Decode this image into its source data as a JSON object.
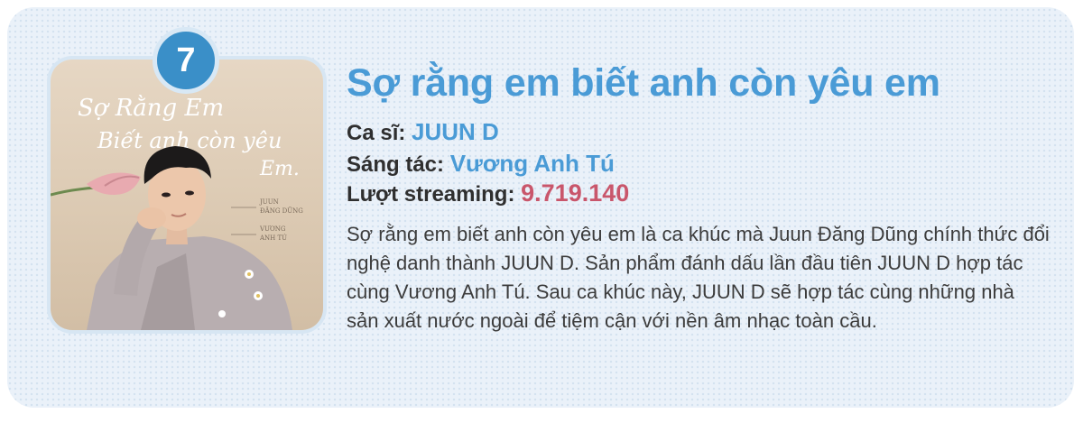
{
  "rank": "7",
  "song": {
    "title": "Sợ rằng em biết anh còn yêu em",
    "cover_handwriting_line1": "Sợ Rằng Em",
    "cover_handwriting_line2": "Biết anh còn yêu",
    "cover_handwriting_line3": "Em.",
    "cover_credit_1a": "JUUN",
    "cover_credit_1b": "ĐĂNG DŨNG",
    "cover_credit_2a": "VƯƠNG",
    "cover_credit_2b": "ANH TÚ"
  },
  "singer": {
    "label": "Ca sĩ:",
    "value": "JUUN D"
  },
  "composer": {
    "label": "Sáng tác:",
    "value": "Vương Anh Tú"
  },
  "streams": {
    "label": "Lượt streaming:",
    "value": "9.719.140"
  },
  "description": "Sợ rằng em biết anh còn yêu em là ca khúc mà Juun Đăng Dũng chính thức đổi nghệ danh thành JUUN D. Sản phẩm đánh dấu lần đầu tiên JUUN D hợp tác cùng Vương Anh Tú. Sau ca khúc này, JUUN D sẽ hợp tác cùng những nhà sản xuất nước ngoài để tiệm cận với nền âm nhạc toàn cầu.",
  "colors": {
    "accent": "#4a9bd6",
    "badge": "#3a8fc8",
    "streams": "#c9566b"
  }
}
